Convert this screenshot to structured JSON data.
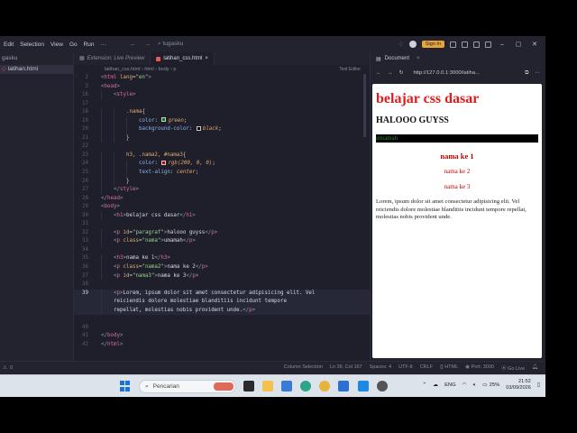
{
  "titlebar": {
    "menu": [
      "Edit",
      "Selection",
      "View",
      "Go",
      "Run",
      "···"
    ],
    "search": "tugasku",
    "signin": "Sign In"
  },
  "explorer": {
    "header": "gasku",
    "file": "latihan.html"
  },
  "tabs": [
    {
      "label": "Extension: Live Preview",
      "active": false
    },
    {
      "label": "latihan_css.html",
      "active": true
    }
  ],
  "breadcrumb": "latihan_css.html › html › body › p",
  "editor": {
    "text_editor_label": "Text Editor"
  },
  "code_lines": [
    {
      "n": "2",
      "indent": 0,
      "html": "<span class='br'>&lt;</span><span class='tag'>html</span> <span class='attr'>lang</span>=<span class='str'>\"en\"</span><span class='br'>&gt;</span>"
    },
    {
      "n": "3",
      "indent": 0,
      "html": "<span class='br'>&lt;</span><span class='tag'>head</span><span class='br'>&gt;</span>"
    },
    {
      "n": "16",
      "indent": 1,
      "html": "<span class='br'>&lt;</span><span class='tag'>style</span><span class='br'>&gt;</span>"
    },
    {
      "n": "17",
      "indent": 0,
      "html": ""
    },
    {
      "n": "18",
      "indent": 2,
      "html": "<span class='sel'>.nama</span>{"
    },
    {
      "n": "19",
      "indent": 3,
      "html": "<span class='prop'>color</span>: <span class='swatch' style='background:#008000'></span><span class='val'>green</span>;"
    },
    {
      "n": "20",
      "indent": 3,
      "html": "<span class='prop'>background-color</span>: <span class='swatch' style='background:#000'></span><span class='val'>black</span>;"
    },
    {
      "n": "21",
      "indent": 2,
      "html": "}"
    },
    {
      "n": "22",
      "indent": 0,
      "html": ""
    },
    {
      "n": "23",
      "indent": 2,
      "html": "<span class='sel'>h3, .nama2, #nama3</span>{"
    },
    {
      "n": "24",
      "indent": 3,
      "html": "<span class='prop'>color</span>: <span class='swatch' style='background:#c80000'></span><span class='val'>rgb(200, 0, 0)</span>;"
    },
    {
      "n": "25",
      "indent": 3,
      "html": "<span class='prop'>text-align</span>: <span class='val'>center</span>;"
    },
    {
      "n": "26",
      "indent": 2,
      "html": "}"
    },
    {
      "n": "27",
      "indent": 1,
      "html": "<span class='br'>&lt;/</span><span class='tag'>style</span><span class='br'>&gt;</span>"
    },
    {
      "n": "28",
      "indent": 0,
      "html": "<span class='br'>&lt;/</span><span class='tag'>head</span><span class='br'>&gt;</span>"
    },
    {
      "n": "29",
      "indent": 0,
      "html": "<span class='br'>&lt;</span><span class='tag'>body</span><span class='br'>&gt;</span>"
    },
    {
      "n": "30",
      "indent": 1,
      "html": "<span class='br'>&lt;</span><span class='tag'>h1</span><span class='br'>&gt;</span><span class='txt'>belajar css dasar</span><span class='br'>&lt;/</span><span class='tag'>h1</span><span class='br'>&gt;</span>"
    },
    {
      "n": "31",
      "indent": 0,
      "html": ""
    },
    {
      "n": "32",
      "indent": 1,
      "html": "<span class='br'>&lt;</span><span class='tag'>p</span> <span class='attr'>id</span>=<span class='str'>\"paragraf\"</span><span class='br'>&gt;</span><span class='txt'>halooo guyss</span><span class='br'>&lt;/</span><span class='tag'>p</span><span class='br'>&gt;</span>"
    },
    {
      "n": "33",
      "indent": 1,
      "html": "<span class='br'>&lt;</span><span class='tag'>p</span> <span class='attr'>class</span>=<span class='str'>\"nama\"</span><span class='br'>&gt;</span><span class='txt'>umamah</span><span class='br'>&lt;/</span><span class='tag'>p</span><span class='br'>&gt;</span>"
    },
    {
      "n": "34",
      "indent": 0,
      "html": ""
    },
    {
      "n": "35",
      "indent": 1,
      "html": "<span class='br'>&lt;</span><span class='tag'>h3</span><span class='br'>&gt;</span><span class='txt'>nama ke 1</span><span class='br'>&lt;/</span><span class='tag'>h3</span><span class='br'>&gt;</span>"
    },
    {
      "n": "36",
      "indent": 1,
      "html": "<span class='br'>&lt;</span><span class='tag'>p</span> <span class='attr'>class</span>=<span class='str'>\"nama2\"</span><span class='br'>&gt;</span><span class='txt'>nama ke 2</span><span class='br'>&lt;/</span><span class='tag'>p</span><span class='br'>&gt;</span>"
    },
    {
      "n": "37",
      "indent": 1,
      "html": "<span class='br'>&lt;</span><span class='tag'>p</span> <span class='attr'>id</span>=<span class='str'>\"nama3\"</span><span class='br'>&gt;</span><span class='txt'>nama ke 3</span><span class='br'>&lt;/</span><span class='tag'>p</span><span class='br'>&gt;</span>"
    },
    {
      "n": "38",
      "indent": 0,
      "html": ""
    },
    {
      "n": "39",
      "indent": 1,
      "current": true,
      "html": "<span class='br'>&lt;</span><span class='tag'>p</span><span class='br'>&gt;</span><span class='txt'>Lorem, ipsum dolor sit amet consectetur adipisicing elit. Vel</span>"
    },
    {
      "n": "",
      "indent": 1,
      "current": true,
      "html": "<span class='txt'>reiciendis dolore molestiae blanditiis incidunt tempore</span>"
    },
    {
      "n": "",
      "indent": 1,
      "current": true,
      "html": "<span class='txt'>repellat, molestias nobis provident unde.</span><span class='br'>&lt;/</span><span class='tag'>p</span><span class='br'>&gt;</span>"
    },
    {
      "n": "",
      "indent": 0,
      "html": ""
    },
    {
      "n": "40",
      "indent": 0,
      "html": ""
    },
    {
      "n": "41",
      "indent": 0,
      "html": "<span class='br'>&lt;/</span><span class='tag'>body</span><span class='br'>&gt;</span>"
    },
    {
      "n": "42",
      "indent": 0,
      "html": "<span class='br'>&lt;/</span><span class='tag'>html</span><span class='br'>&gt;</span>"
    }
  ],
  "preview": {
    "tab_label": "Document",
    "url": "http://127.0.0.1:3000/latiha...",
    "h1": "belajar css dasar",
    "greeting": "HALOOO GUYSS",
    "umamah": "umamah",
    "h3": "nama ke 1",
    "nama2": "nama ke 2",
    "nama3": "nama ke 3",
    "lorem": "Lorem, ipsum dolor sit amet consectetur adipisicing elit. Vel reiciendis dolore molestiae blanditiis incidunt tempore repellat, molestias nobis provident unde."
  },
  "statusbar": {
    "problems": "0",
    "column_selection": "Column Selection",
    "position": "Ln 39, Col 167",
    "spaces": "Spaces: 4",
    "encoding": "UTF-8",
    "eol": "CRLF",
    "language": "HTML",
    "port": "Port: 3000",
    "golive": "Go Live"
  },
  "taskbar": {
    "search_placeholder": "Pencarian",
    "lang": "ENG",
    "battery": "25%",
    "time": "21:52",
    "date": "03/09/2026"
  },
  "colors": {
    "accent": "#e8a33c",
    "editor_bg": "#1e1f2b",
    "preview_h1": "#e01b1b"
  }
}
